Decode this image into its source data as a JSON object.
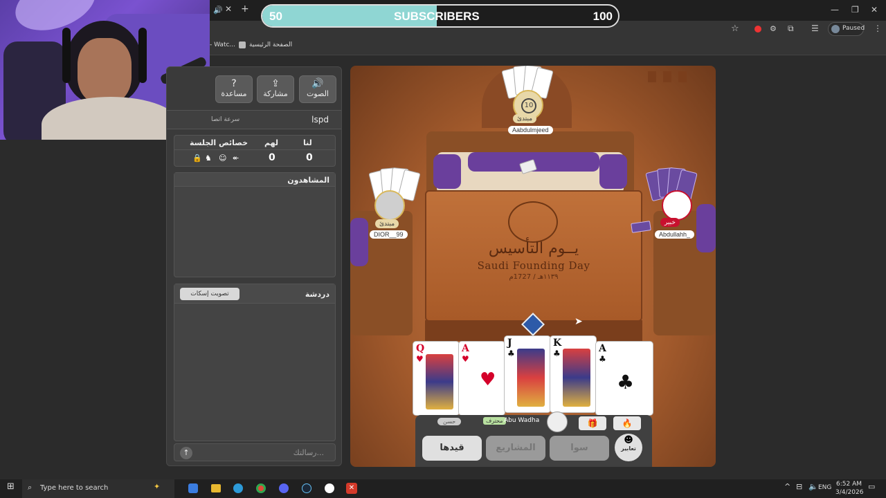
{
  "overlay": {
    "sub_start": "50",
    "sub_label": "SUBSCRIBERS",
    "sub_goal": "100",
    "progress_fraction": 0.49
  },
  "browser": {
    "tab_label": "- Watc...",
    "bookmark": "الصفحة الرئيسية",
    "profile_label": "Paused"
  },
  "panel": {
    "toolbar": {
      "sound": "الصوت",
      "share": "مشاركة",
      "help": "مساعدة"
    },
    "room_name": "lspd",
    "speed_label": "سرعة اتصا",
    "score": {
      "us_label": "لنا",
      "them_label": "لهم",
      "props_label": "خصائص الجلسة",
      "us": "0",
      "them": "0"
    },
    "spectators_label": "المشاهدون",
    "chat_label": "دردشة",
    "mute_vote": "تصويت إسكات",
    "message_placeholder": "رسالتك..."
  },
  "game": {
    "top_player": {
      "name": "Aabdulmjeed",
      "badge": "مبتدئ",
      "count": "10"
    },
    "left_player": {
      "name": "DIOR__99",
      "badge": "مبتدئ"
    },
    "right_player": {
      "name": "Abdullahh_",
      "badge": "خبير"
    },
    "table_ar": "يــوم التأسيس",
    "table_en": "Saudi Founding Day",
    "table_date": "١١٣٩هـ / 1727م",
    "hand": [
      "Q",
      "A",
      "J",
      "K",
      "A"
    ],
    "self": {
      "name": "Abu Wadha",
      "badge_left": "حسن",
      "badge_mid": "محترف"
    },
    "buttons": {
      "qaydha": "قيدها",
      "projects": "المشاريع",
      "sawa": "سوا",
      "emotes": "تعابير"
    }
  },
  "taskbar": {
    "search": "Type here to search",
    "lang": "ENG",
    "time": "6:52 AM",
    "date": "3/4/2026"
  },
  "colors": {
    "accent": "#8fd6d3",
    "suit_red": "#d4002a",
    "purple": "#6a3f9c",
    "expert_red": "#c8102e"
  }
}
